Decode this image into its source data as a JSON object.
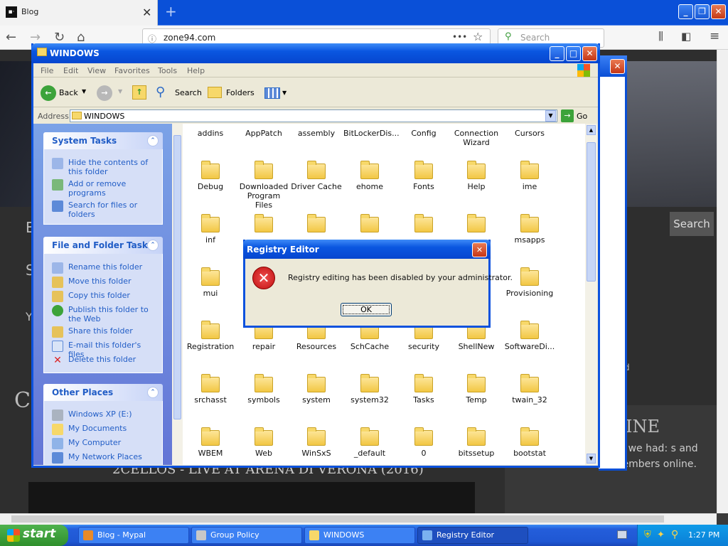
{
  "browser": {
    "tab_title": "Blog",
    "tab_icon": "blog-favicon",
    "tab_close": "✕",
    "new_tab": "+",
    "url": "zone94.com",
    "url_dots": "•••",
    "search_placeholder": "Search"
  },
  "site": {
    "search_button": "Search",
    "online_title": "INE",
    "online_text": "nutes we had: s and no members online.",
    "video_title": "2CELLOS - LIVE AT ARENA DI VERONA (2016)",
    "left_fragments": [
      "E",
      "S",
      "Y",
      "CE"
    ],
    "right_fragment": "d"
  },
  "explorer": {
    "title": "WINDOWS",
    "menu": [
      "File",
      "Edit",
      "View",
      "Favorites",
      "Tools",
      "Help"
    ],
    "toolbar": {
      "back": "Back",
      "search": "Search",
      "folders": "Folders"
    },
    "address_label": "Address",
    "address_value": "WINDOWS",
    "go": "Go",
    "system_tasks": {
      "title": "System Tasks",
      "items": [
        "Hide the contents of this folder",
        "Add or remove programs",
        "Search for files or folders"
      ]
    },
    "file_tasks": {
      "title": "File and Folder Tasks",
      "items": [
        "Rename this folder",
        "Move this folder",
        "Copy this folder",
        "Publish this folder to the Web",
        "Share this folder",
        "E-mail this folder's files",
        "Delete this folder"
      ]
    },
    "other_places": {
      "title": "Other Places",
      "items": [
        "Windows XP (E:)",
        "My Documents",
        "My Computer",
        "My Network Places"
      ]
    },
    "folders": [
      [
        "addins",
        "AppPatch",
        "assembly",
        "BitLockerDis...",
        "Config",
        "Connection Wizard",
        "Cursors"
      ],
      [
        "Debug",
        "Downloaded Program Files",
        "Driver Cache",
        "ehome",
        "Fonts",
        "Help",
        "ime"
      ],
      [
        "inf",
        "",
        "",
        "",
        "",
        "",
        "msapps"
      ],
      [
        "mui",
        "",
        "",
        "",
        "",
        "",
        "Provisioning"
      ],
      [
        "Registration",
        "repair",
        "Resources",
        "SchCache",
        "security",
        "ShellNew",
        "SoftwareDi..."
      ],
      [
        "srchasst",
        "symbols",
        "system",
        "system32",
        "Tasks",
        "Temp",
        "twain_32"
      ],
      [
        "WBEM",
        "Web",
        "WinSxS",
        "_default",
        "0",
        "bitssetup",
        "bootstat"
      ]
    ]
  },
  "dialog": {
    "title": "Registry Editor",
    "message": "Registry editing has been disabled by your administrator.",
    "ok": "OK",
    "icon": "error-icon"
  },
  "taskbar": {
    "start": "start",
    "items": [
      "Blog - Mypal",
      "Group Policy",
      "WINDOWS",
      "Registry Editor"
    ],
    "active": "Registry Editor",
    "clock": "1:27 PM"
  }
}
